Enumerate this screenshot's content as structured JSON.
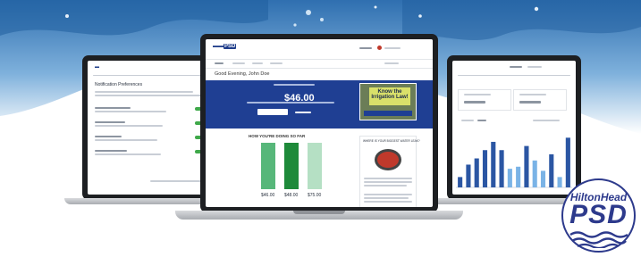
{
  "brand": {
    "logo_top": "HiltonHead",
    "logo_main": "PSD",
    "primary_color": "#1f3f93",
    "accent_color": "#2d3a8c",
    "water_color": "#4f8fc6"
  },
  "center_laptop": {
    "greeting": "Good Evening, John Doe",
    "amount": "$46.00",
    "banner_title": "Know the Irrigation Law!",
    "panel_title": "HOW YOU'RE DOING SO FAR",
    "bar_values": [
      "$46.00",
      "$48.00",
      "$75.00"
    ],
    "card_title": "WHERE IS YOUR BIGGEST WATER LEAK?"
  },
  "left_laptop": {
    "page_title": "Notification Preferences"
  },
  "right_laptop": {
    "chart_bars": [
      {
        "value": 1.0,
        "color": "#2b56a3"
      },
      {
        "value": 2.2,
        "color": "#2b56a3"
      },
      {
        "value": 2.8,
        "color": "#2b56a3"
      },
      {
        "value": 3.6,
        "color": "#2b56a3"
      },
      {
        "value": 4.4,
        "color": "#2b56a3"
      },
      {
        "value": 3.6,
        "color": "#2b56a3"
      },
      {
        "value": 1.8,
        "color": "#7ab3e6"
      },
      {
        "value": 2.0,
        "color": "#7ab3e6"
      },
      {
        "value": 4.0,
        "color": "#2b56a3"
      },
      {
        "value": 2.6,
        "color": "#7ab3e6"
      },
      {
        "value": 1.6,
        "color": "#7ab3e6"
      },
      {
        "value": 3.2,
        "color": "#2b56a3"
      },
      {
        "value": 1.0,
        "color": "#7ab3e6"
      },
      {
        "value": 4.8,
        "color": "#2b56a3"
      }
    ]
  }
}
